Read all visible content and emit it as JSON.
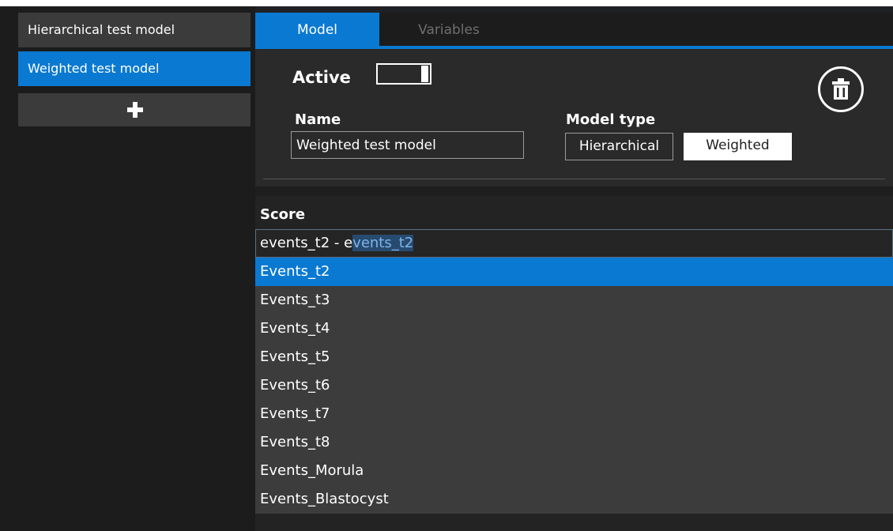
{
  "sidebar": {
    "items": [
      {
        "label": "Hierarchical test model",
        "active": false
      },
      {
        "label": "Weighted test model",
        "active": true
      }
    ],
    "add_icon": "plus-icon"
  },
  "tabs": [
    {
      "label": "Model",
      "active": true
    },
    {
      "label": "Variables",
      "active": false
    }
  ],
  "model": {
    "active_label": "Active",
    "active_on": true,
    "delete_icon": "trash-icon",
    "name_label": "Name",
    "name_value": "Weighted test model",
    "model_type_label": "Model type",
    "model_types": [
      {
        "label": "Hierarchical",
        "selected": false
      },
      {
        "label": "Weighted",
        "selected": true
      }
    ]
  },
  "score": {
    "label": "Score",
    "typed_text": "events_t2 - e",
    "autocomplete_text": "vents_t2",
    "options": [
      "Events_t2",
      "Events_t3",
      "Events_t4",
      "Events_t5",
      "Events_t6",
      "Events_t7",
      "Events_t8",
      "Events_Morula",
      "Events_Blastocyst"
    ],
    "highlighted_index": 0
  },
  "colors": {
    "accent": "#0a79d1",
    "background": "#202124",
    "panel": "#2a2a2a",
    "dropdown": "#3c3c3c"
  }
}
